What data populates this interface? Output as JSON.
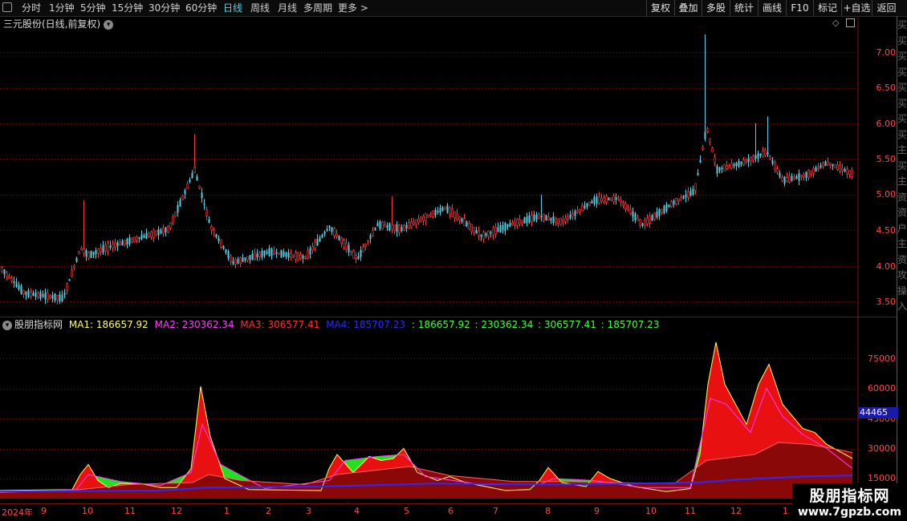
{
  "toolbar": {
    "periods": [
      "分时",
      "1分钟",
      "5分钟",
      "15分钟",
      "30分钟",
      "60分钟",
      "日线",
      "周线",
      "月线",
      "多周期",
      "更多 >"
    ],
    "active_period": "日线",
    "right_buttons": [
      "复权",
      "叠加",
      "多股",
      "统计",
      "画线",
      "F10",
      "标记",
      "+自选",
      "返回"
    ]
  },
  "price_panel": {
    "title": "三元股份(日线,前复权)",
    "y_ticks": [
      "7.00",
      "6.50",
      "6.00",
      "5.50",
      "5.00",
      "4.50",
      "4.00",
      "3.50"
    ],
    "colors": {
      "up": "#ff3a3a",
      "down": "#54d0e6",
      "grid": "#7a1010"
    }
  },
  "indicator_panel": {
    "name": "股朋指标网",
    "legend": [
      {
        "text": "MA1: 186657.92",
        "color": "#ffff60"
      },
      {
        "text": "MA2: 230362.34",
        "color": "#ff40ff"
      },
      {
        "text": "MA3: 306577.41",
        "color": "#ff3030"
      },
      {
        "text": "MA4: 185707.23",
        "color": "#2a2aff"
      },
      {
        "text": ": 186657.92",
        "color": "#40ff40"
      },
      {
        "text": ": 230362.34",
        "color": "#40ff40"
      },
      {
        "text": ": 306577.41",
        "color": "#40ff40"
      },
      {
        "text": ": 185707.23",
        "color": "#40ff40"
      }
    ],
    "y_ticks": [
      "75000",
      "60000",
      "45000",
      "30000",
      "15000"
    ],
    "current_value": "44465"
  },
  "time_axis": {
    "labels": [
      "2024年",
      "9",
      "10",
      "11",
      "12",
      "1",
      "2",
      "3",
      "4",
      "5",
      "6",
      "7",
      "8",
      "9",
      "10",
      "11",
      "12",
      "1"
    ]
  },
  "side_text": "买买买买买买买买主买主资资户主资攻操入",
  "watermark": {
    "title": "股朋指标网",
    "url": "www.7gpzb.com"
  }
}
